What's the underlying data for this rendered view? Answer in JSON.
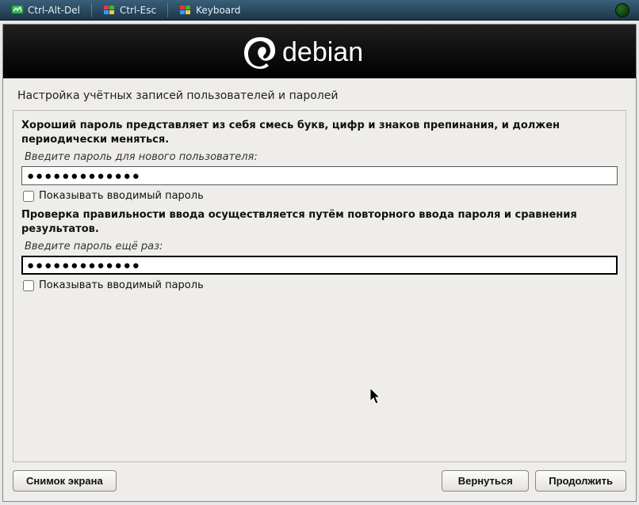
{
  "toolbar": {
    "ctrl_alt_del": "Ctrl-Alt-Del",
    "ctrl_esc": "Ctrl-Esc",
    "keyboard": "Keyboard"
  },
  "banner": {
    "brand": "debian"
  },
  "page": {
    "title": "Настройка учётных записей пользователей и паролей",
    "intro": "Хороший пароль представляет из себя смесь букв, цифр и знаков препинания, и должен периодически меняться.",
    "pw1_label": "Введите пароль для нового пользователя:",
    "pw1_value": "●●●●●●●●●●●●●",
    "show1": "Показывать вводимый пароль",
    "verify_text": "Проверка правильности ввода осуществляется путём повторного ввода пароля и сравнения результатов.",
    "pw2_label": "Введите пароль ещё раз:",
    "pw2_value": "●●●●●●●●●●●●●",
    "show2": "Показывать вводимый пароль"
  },
  "buttons": {
    "screenshot": "Снимок экрана",
    "back": "Вернуться",
    "continue": "Продолжить"
  }
}
